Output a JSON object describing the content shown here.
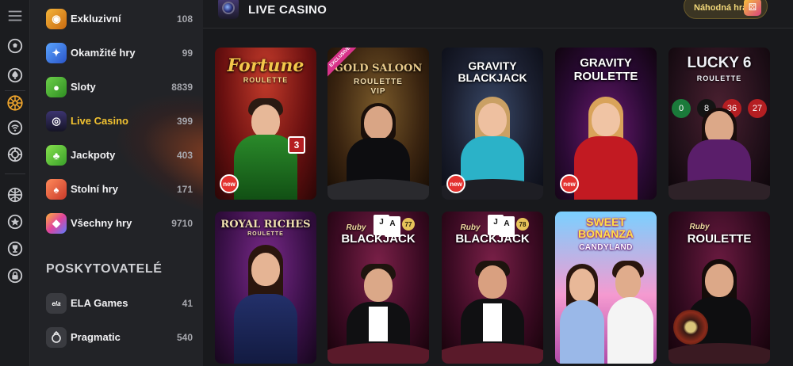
{
  "rail": {
    "icons": [
      "hamburger-menu-icon",
      "soccer-ball-icon",
      "spade-icon",
      "roulette-wheel-icon",
      "live-signal-icon",
      "bet-icon",
      "sport-icon",
      "star-icon",
      "trophy-icon",
      "lock-icon"
    ]
  },
  "menu": {
    "items": [
      {
        "label": "Exkluzivní",
        "count": "108",
        "icon": "exclusive-icon",
        "color": "#e89a1c"
      },
      {
        "label": "Okamžité hry",
        "count": "99",
        "icon": "instant-games-icon",
        "color": "#3b7be8"
      },
      {
        "label": "Sloty",
        "count": "8839",
        "icon": "slots-cherry-icon",
        "color": "#47b43a"
      },
      {
        "label": "Live Casino",
        "count": "399",
        "icon": "live-camera-icon",
        "color": "#2a2c55"
      },
      {
        "label": "Jackpoty",
        "count": "403",
        "icon": "jackpot-icon",
        "color": "#58c23a"
      },
      {
        "label": "Stolní hry",
        "count": "171",
        "icon": "table-games-icon",
        "color": "#e2563a"
      },
      {
        "label": "Všechny hry",
        "count": "9710",
        "icon": "all-games-icon",
        "color": "#d8449a"
      }
    ],
    "active_index": 3,
    "providers_heading": "POSKYTOVATELÉ",
    "providers": [
      {
        "label": "ELA Games",
        "count": "41",
        "icon": "ela-games-logo-icon",
        "logo_text": "ela"
      },
      {
        "label": "Pragmatic",
        "count": "540",
        "icon": "pragmatic-logo-icon"
      }
    ]
  },
  "header": {
    "title": "LIVE CASINO",
    "random_button": "Náhodná hra"
  },
  "games": [
    {
      "title": "Fortune",
      "subtitle": "ROULETTE",
      "badge": "new",
      "accent": "#d4a63a"
    },
    {
      "title": "GOLD SALOON",
      "subtitle": "ROULETTE VIP",
      "badge": "EXCLUSIVE",
      "accent": "#c89b4a"
    },
    {
      "title": "GRAVITY BLACKJACK",
      "subtitle": "",
      "badge": "new",
      "accent": "#f4d35e"
    },
    {
      "title": "GRAVITY ROULETTE",
      "subtitle": "",
      "badge": "new",
      "accent": "#f4d35e"
    },
    {
      "title": "LUCKY 6",
      "subtitle": "ROULETTE",
      "badge": "",
      "accent": "#d8d8e8"
    },
    {
      "title": "ROYAL RICHES",
      "subtitle": "ROULETTE",
      "badge": "",
      "accent": "#e9d49a"
    },
    {
      "title": "BLACKJACK",
      "subtitle": "Ruby",
      "badge": "77",
      "accent": "#e7c35a"
    },
    {
      "title": "BLACKJACK",
      "subtitle": "Ruby",
      "badge": "78",
      "accent": "#e7c35a"
    },
    {
      "title": "SWEET BONANZA",
      "subtitle": "CANDYLAND",
      "badge": "",
      "accent": "#ff5fa8"
    },
    {
      "title": "ROULETTE",
      "subtitle": "Ruby",
      "badge": "",
      "accent": "#e7c35a"
    }
  ]
}
